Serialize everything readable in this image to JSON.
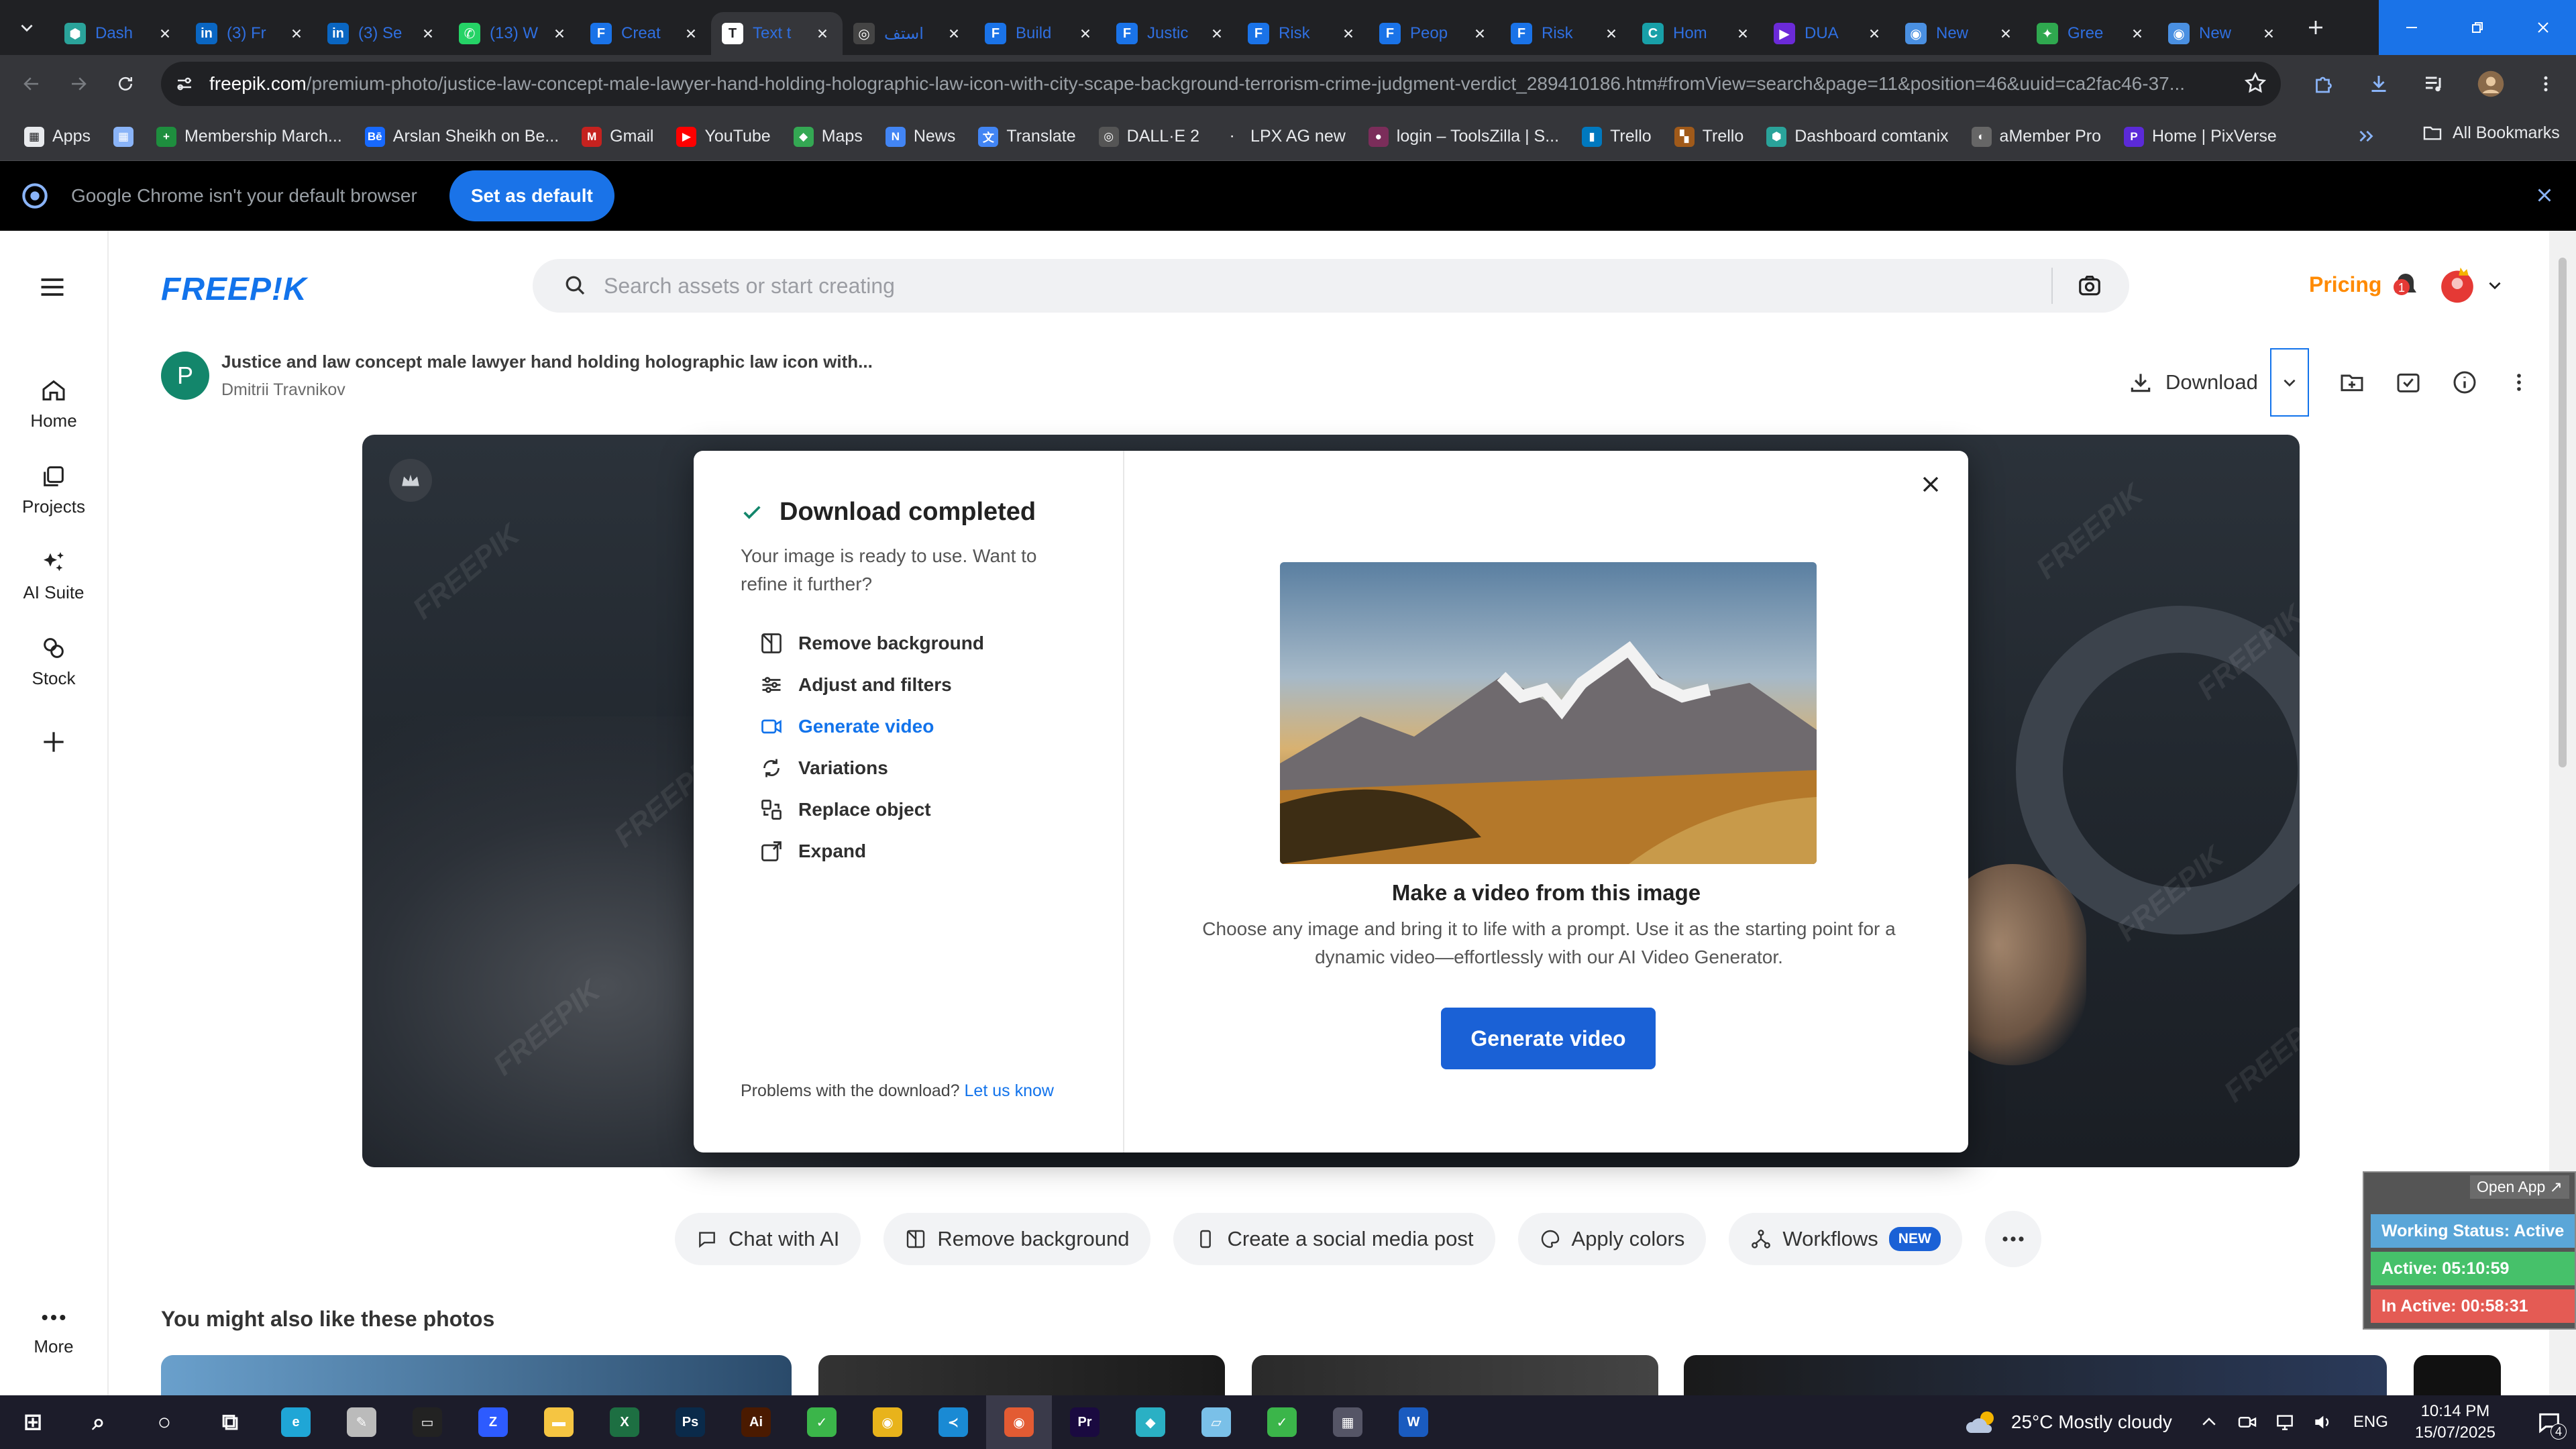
{
  "browser": {
    "tabs": [
      {
        "label": "Dash",
        "color": "#2aa39a",
        "glyph": "⬢"
      },
      {
        "label": "(3) Fr",
        "color": "#0a66c2",
        "glyph": "in"
      },
      {
        "label": "(3) Se",
        "color": "#0a66c2",
        "glyph": "in"
      },
      {
        "label": "(13) W",
        "color": "#25d366",
        "glyph": "✆"
      },
      {
        "label": "Creat",
        "color": "#1a73e8",
        "glyph": "F"
      },
      {
        "label": "Text t",
        "color": "#ffffff",
        "glyph": "T"
      },
      {
        "label": "استف",
        "color": "#444444",
        "glyph": "◎"
      },
      {
        "label": "Build",
        "color": "#1a73e8",
        "glyph": "F"
      },
      {
        "label": "Justic",
        "color": "#1a73e8",
        "glyph": "F"
      },
      {
        "label": "Risk",
        "color": "#1a73e8",
        "glyph": "F"
      },
      {
        "label": "Peop",
        "color": "#1a73e8",
        "glyph": "F"
      },
      {
        "label": "Risk",
        "color": "#1a73e8",
        "glyph": "F"
      },
      {
        "label": "Hom",
        "color": "#18a0a8",
        "glyph": "C"
      },
      {
        "label": "DUA",
        "color": "#6b2ad8",
        "glyph": "▶"
      },
      {
        "label": "New",
        "color": "#4a90e2",
        "glyph": "◉"
      },
      {
        "label": "Gree",
        "color": "#2fa84f",
        "glyph": "✦"
      },
      {
        "label": "New",
        "color": "#4a90e2",
        "glyph": "◉"
      }
    ],
    "active_tab_index": 5,
    "url_domain": "freepik.com",
    "url_path": "/premium-photo/justice-law-concept-male-lawyer-hand-holding-holographic-law-icon-with-city-scape-background-terrorism-crime-judgment-verdict_289410186.htm#fromView=search&page=11&position=46&uuid=ca2fac46-37...",
    "bookmarks": [
      {
        "label": "Apps",
        "color": "#e8eaed",
        "glyph": "▦"
      },
      {
        "label": "",
        "color": "#8ab4f8",
        "glyph": "▦"
      },
      {
        "label": "Membership March...",
        "color": "#1e8e3e",
        "glyph": "+"
      },
      {
        "label": "Arslan Sheikh on Be...",
        "color": "#1769ff",
        "glyph": "Bē"
      },
      {
        "label": "Gmail",
        "color": "#c5221f",
        "glyph": "M"
      },
      {
        "label": "YouTube",
        "color": "#ff0000",
        "glyph": "▶"
      },
      {
        "label": "Maps",
        "color": "#34a853",
        "glyph": "◆"
      },
      {
        "label": "News",
        "color": "#4285f4",
        "glyph": "N"
      },
      {
        "label": "Translate",
        "color": "#4285f4",
        "glyph": "文"
      },
      {
        "label": "DALL·E 2",
        "color": "#555555",
        "glyph": "◎"
      },
      {
        "label": "LPX AG new",
        "color": "#35363a",
        "glyph": "·"
      },
      {
        "label": "login – ToolsZilla | S...",
        "color": "#7b2d5a",
        "glyph": "●"
      },
      {
        "label": "Trello",
        "color": "#0079bf",
        "glyph": "▮"
      },
      {
        "label": "Trello",
        "color": "#a05a1a",
        "glyph": "▚"
      },
      {
        "label": "Dashboard comtanix",
        "color": "#2aa39a",
        "glyph": "⬢"
      },
      {
        "label": "aMember Pro",
        "color": "#666666",
        "glyph": "◐"
      },
      {
        "label": "Home | PixVerse",
        "color": "#5b2ad8",
        "glyph": "P"
      }
    ],
    "all_bookmarks": "All Bookmarks",
    "default_msg": "Google Chrome isn't your default browser",
    "set_default": "Set as default"
  },
  "site": {
    "logo": "FREEP!K",
    "search_placeholder": "Search assets or start creating",
    "pricing": "Pricing",
    "notif_count": "1",
    "rail": [
      {
        "label": "Home",
        "icon": "home-icon"
      },
      {
        "label": "Projects",
        "icon": "projects-icon"
      },
      {
        "label": "AI Suite",
        "icon": "ai-suite-icon"
      },
      {
        "label": "Stock",
        "icon": "stock-icon"
      }
    ],
    "rail_more": "More",
    "asset_title": "Justice and law concept male lawyer hand holding holographic law icon with...",
    "author_initial": "P",
    "author_name": "Dmitrii Travnikov",
    "download": "Download",
    "watermark": "FREEPIK"
  },
  "modal": {
    "title": "Download completed",
    "subtitle": "Your image is ready to use. Want to refine it further?",
    "tools": [
      {
        "label": "Remove background",
        "icon": "remove-background-icon",
        "highlight": false
      },
      {
        "label": "Adjust and filters",
        "icon": "sliders-icon",
        "highlight": false
      },
      {
        "label": "Generate video",
        "icon": "video-icon",
        "highlight": true
      },
      {
        "label": "Variations",
        "icon": "variations-icon",
        "highlight": false
      },
      {
        "label": "Replace object",
        "icon": "replace-object-icon",
        "highlight": false
      },
      {
        "label": "Expand",
        "icon": "expand-icon",
        "highlight": false
      }
    ],
    "problem_text": "Problems with the download?",
    "problem_link": "Let us know",
    "make_title": "Make a video from this image",
    "make_desc": "Choose any image and bring it to life with a prompt. Use it as the starting point for a dynamic video—effortlessly with our AI Video Generator.",
    "generate_btn": "Generate video"
  },
  "chips": [
    {
      "label": "Chat with AI",
      "icon": "chat-icon"
    },
    {
      "label": "Remove background",
      "icon": "remove-background-icon"
    },
    {
      "label": "Create a social media post",
      "icon": "phone-icon"
    },
    {
      "label": "Apply colors",
      "icon": "palette-icon"
    },
    {
      "label": "Workflows",
      "icon": "workflow-icon",
      "badge": "NEW"
    }
  ],
  "also_title": "You might also like these photos",
  "widget": {
    "open_app": "Open App ↗",
    "status": "Working Status: Active",
    "active": "Active: 05:10:59",
    "inactive": "In Active: 00:58:31"
  },
  "taskbar": {
    "apps": [
      {
        "name": "start",
        "color": "#ffffff",
        "glyph": "⊞"
      },
      {
        "name": "search",
        "color": "#ffffff",
        "glyph": "⌕"
      },
      {
        "name": "cortana",
        "color": "#ffffff",
        "glyph": "○"
      },
      {
        "name": "task-view",
        "color": "#ffffff",
        "glyph": "⧉"
      },
      {
        "name": "edge",
        "color": "#1fa6d6",
        "glyph": "e"
      },
      {
        "name": "pen",
        "color": "#bbbbbb",
        "glyph": "✎"
      },
      {
        "name": "terminal",
        "color": "#222222",
        "glyph": "▭"
      },
      {
        "name": "zoom",
        "color": "#2d5bff",
        "glyph": "Z"
      },
      {
        "name": "file-explorer",
        "color": "#f5c542",
        "glyph": "▬"
      },
      {
        "name": "excel",
        "color": "#1d6f42",
        "glyph": "X"
      },
      {
        "name": "photoshop",
        "color": "#0a2a4a",
        "glyph": "Ps"
      },
      {
        "name": "illustrator",
        "color": "#4a1a00",
        "glyph": "Ai"
      },
      {
        "name": "greenapp",
        "color": "#3bb54a",
        "glyph": "✓"
      },
      {
        "name": "chrome",
        "color": "#e8b31b",
        "glyph": "◉"
      },
      {
        "name": "vscode",
        "color": "#1a8ad4",
        "glyph": "≺"
      },
      {
        "name": "chrome-active",
        "color": "#e35b33",
        "glyph": "◉"
      },
      {
        "name": "premiere",
        "color": "#1a0a40",
        "glyph": "Pr"
      },
      {
        "name": "app3d",
        "color": "#2ab0c4",
        "glyph": "◆"
      },
      {
        "name": "notes",
        "color": "#7ac0e8",
        "glyph": "▱"
      },
      {
        "name": "greenapp2",
        "color": "#3bb54a",
        "glyph": "✓"
      },
      {
        "name": "calculator",
        "color": "#555566",
        "glyph": "▦"
      },
      {
        "name": "word",
        "color": "#1a5bbf",
        "glyph": "W"
      }
    ],
    "weather": "25°C  Mostly cloudy",
    "lang": "ENG",
    "time": "10:14 PM",
    "date": "15/07/2025",
    "notif": "4"
  }
}
